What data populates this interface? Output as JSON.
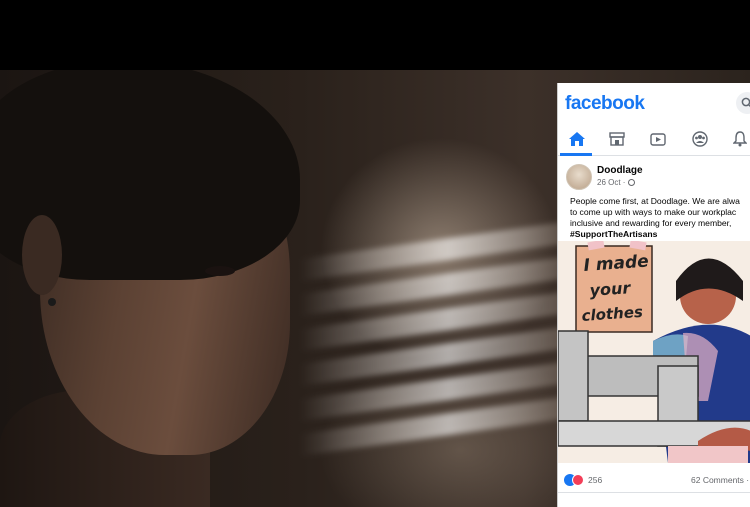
{
  "facebook": {
    "logo": "facebook",
    "nav": [
      "home-icon",
      "marketplace-icon",
      "watch-icon",
      "groups-icon",
      "notifications-icon"
    ],
    "post": {
      "page_name": "Doodlage",
      "date": "26 Oct ·",
      "text_lines": [
        "People come first, at Doodlage. We are alwa",
        "to come up with ways to make our workplac",
        "inclusive and rewarding for every member,"
      ],
      "hashtag": "#SupportTheArtisans",
      "image_sign_text": [
        "I made",
        "your",
        "clothes"
      ],
      "reaction_count": "256",
      "comments": "62 Comments ·"
    },
    "colors": {
      "brand": "#1877f2",
      "like": "#1877f2",
      "love": "#f33e58"
    }
  }
}
